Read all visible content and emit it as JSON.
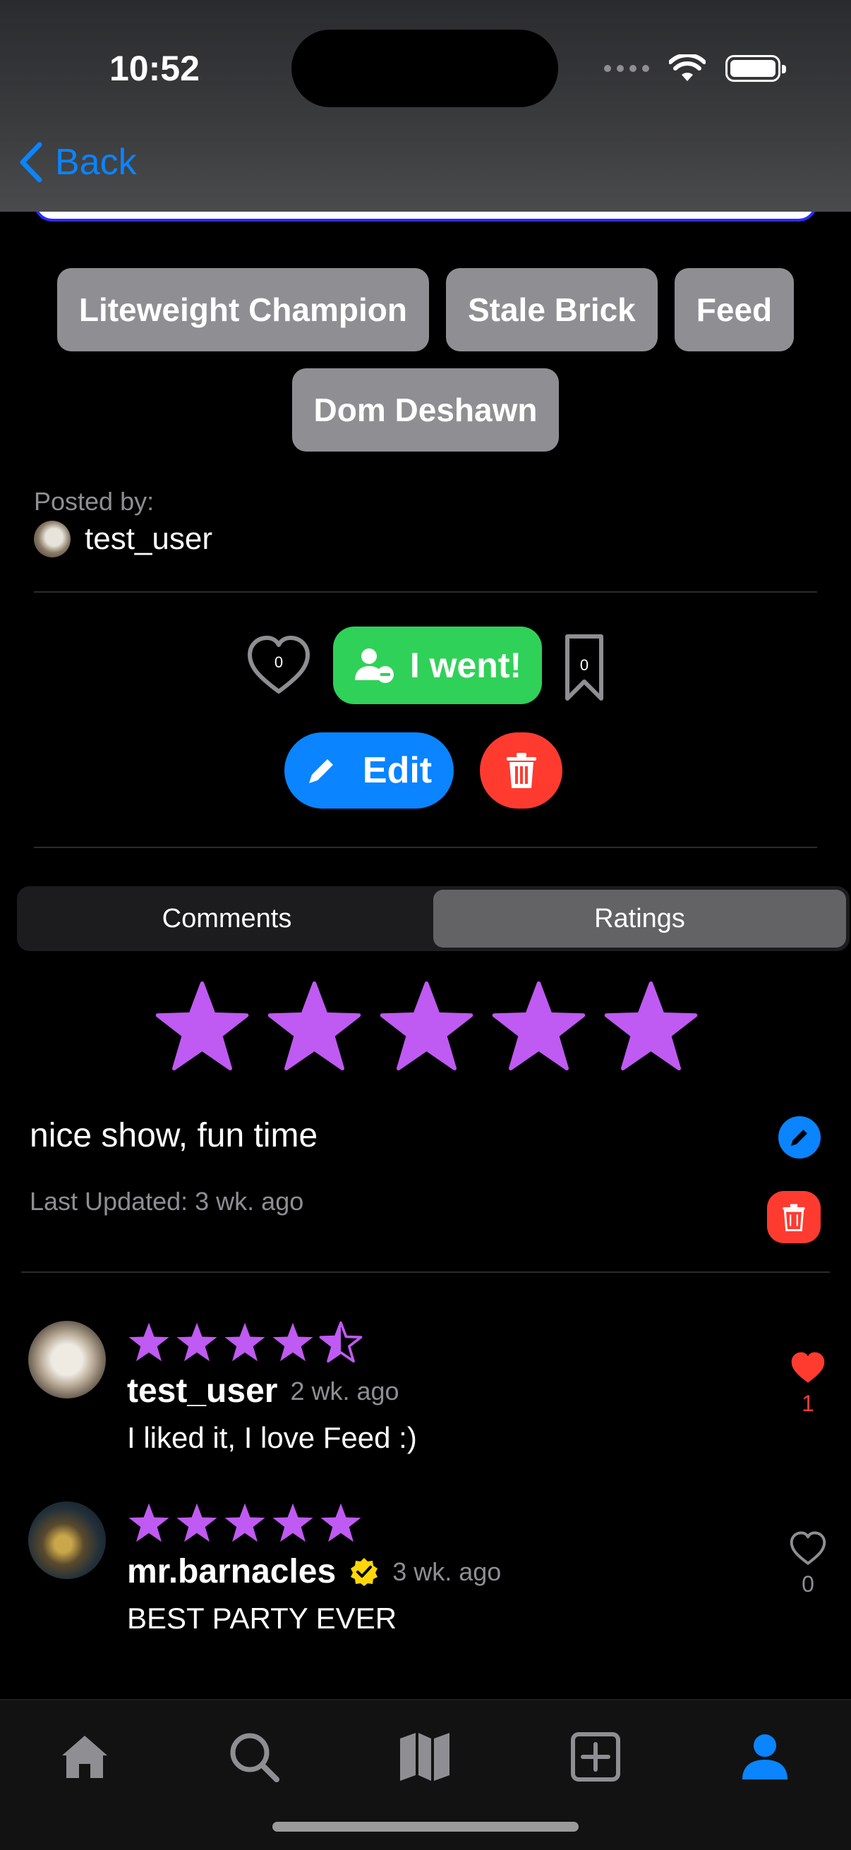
{
  "status_bar": {
    "time": "10:52"
  },
  "nav": {
    "back_label": "Back"
  },
  "tags": [
    "Liteweight Champion",
    "Stale Brick",
    "Feed",
    "Dom Deshawn"
  ],
  "post": {
    "posted_by_label": "Posted by:",
    "username": "test_user"
  },
  "actions": {
    "like_count": "0",
    "went_label": "I went!",
    "bookmark_count": "0",
    "edit_label": "Edit"
  },
  "segment": {
    "tabs": [
      "Comments",
      "Ratings"
    ],
    "active": "Ratings"
  },
  "my_rating": {
    "stars": 5,
    "text": "nice show, fun time",
    "last_updated": "Last Updated: 3 wk. ago"
  },
  "reviews": [
    {
      "username": "test_user",
      "time": "2 wk. ago",
      "text": "I liked it, I love Feed :)",
      "rating": 4.5,
      "likes": "1",
      "liked": true,
      "verified": false
    },
    {
      "username": "mr.barnacles",
      "time": "3 wk. ago",
      "text": "BEST PARTY EVER",
      "rating": 5,
      "likes": "0",
      "liked": false,
      "verified": true
    }
  ],
  "tabbar": {
    "items": [
      "home-icon",
      "search-icon",
      "map-icon",
      "add-icon",
      "profile-icon"
    ],
    "active": "profile-icon"
  },
  "colors": {
    "accent": "#0a84ff",
    "star": "#bf5af2",
    "went": "#30d158",
    "danger": "#ff3b30",
    "tag": "#8e8e93"
  }
}
